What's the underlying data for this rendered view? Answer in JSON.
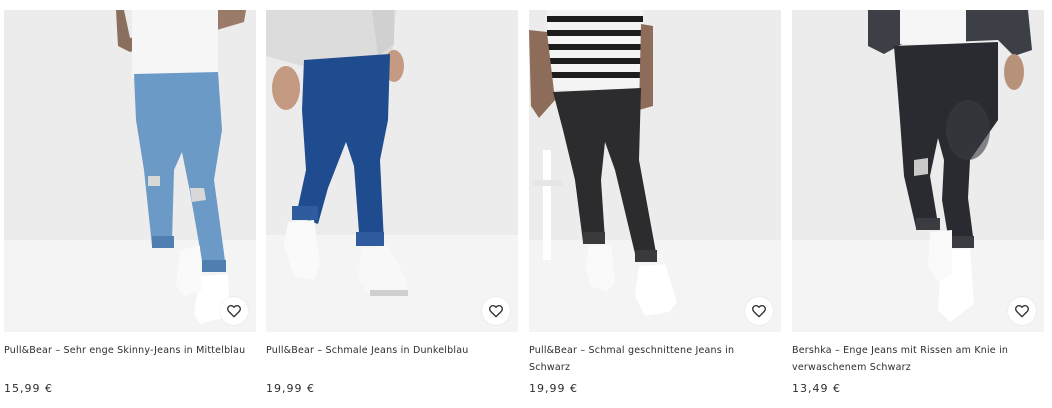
{
  "products": [
    {
      "name": "Pull&Bear – Sehr enge Skinny-Jeans in Mittelblau",
      "price": "15,99 €",
      "save_icon": "heart-outline-icon"
    },
    {
      "name": "Pull&Bear – Schmale Jeans in Dunkelblau",
      "price": "19,99 €",
      "save_icon": "heart-outline-icon"
    },
    {
      "name": "Pull&Bear – Schmal geschnittene Jeans in Schwarz",
      "price": "19,99 €",
      "save_icon": "heart-outline-icon"
    },
    {
      "name": "Bershka – Enge Jeans mit Rissen am Knie in verwaschenem Schwarz",
      "price": "13,49 €",
      "save_icon": "heart-outline-icon"
    }
  ],
  "colors": {
    "text": "#2d2d2d",
    "photo_background": "#eeeeee",
    "jeans": [
      "#6b9ac7",
      "#1f4c8f",
      "#2c2c2e",
      "#2a2b30"
    ]
  }
}
